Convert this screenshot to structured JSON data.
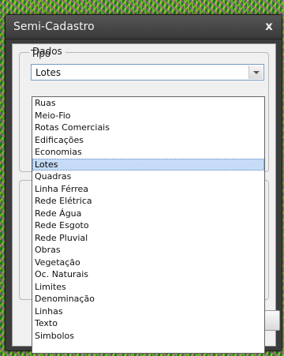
{
  "window": {
    "title": "Semi-Cadastro",
    "close_glyph": "x"
  },
  "group_dados": {
    "label": "Dados",
    "tipo_label": "Tipo",
    "tipo_value": "Lotes"
  },
  "dropdown": {
    "items": [
      "Ruas",
      "Meio-Fio",
      "Rotas Comerciais",
      "Edificações",
      "Economias",
      "Lotes",
      "Quadras",
      "Linha Férrea",
      "Rede Elétrica",
      "Rede Água",
      "Rede Esgoto",
      "Rede Pluvial",
      "Obras",
      "Vegetação",
      "Oc. Naturais",
      "Limites",
      "Denominação",
      "Linhas",
      "Texto",
      "Simbolos"
    ],
    "selected": "Lotes"
  },
  "icons": {
    "close": "close-icon",
    "combo_arrow": "chevron-down-icon"
  }
}
